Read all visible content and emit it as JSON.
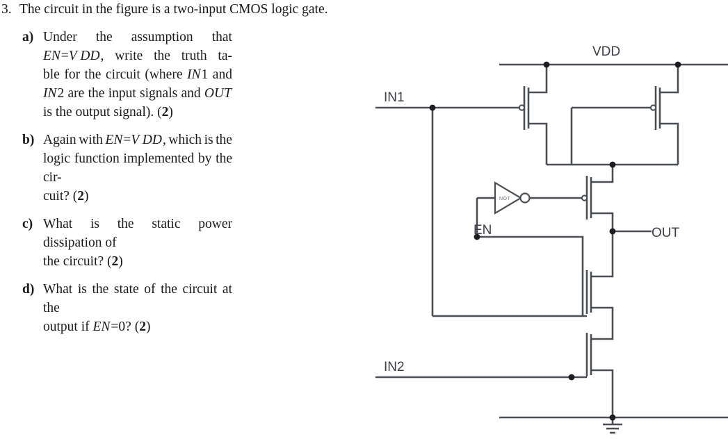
{
  "question": {
    "number": "3.",
    "stem": "The circuit in the figure is a two-input CMOS logic gate.",
    "items": [
      {
        "label": "a)",
        "lines": [
          {
            "words": [
              "Under",
              "the",
              "assumption",
              "that"
            ],
            "spread": true
          },
          {
            "words": [
              "EN=VDD,",
              "write",
              "the",
              "truth",
              "ta-"
            ],
            "spread": true,
            "italic_first": true
          },
          {
            "words": [
              "ble",
              "for",
              "the",
              "circuit",
              "(where",
              "IN1",
              "and"
            ],
            "spread": true
          },
          {
            "words": [
              "IN2",
              "are",
              "the",
              "input",
              "signals",
              "and",
              "OUT"
            ],
            "spread": true
          },
          {
            "words": [
              "is the output signal). (2)"
            ],
            "spread": false
          }
        ],
        "plain": "Under the assumption that EN=VDD, write the truth table for the circuit (where IN1 and IN2 are the input signals and OUT is the output signal). (2)",
        "points": "2"
      },
      {
        "label": "b)",
        "lines": [
          {
            "words": [
              "Again",
              "with",
              "EN=VDD,",
              "which",
              "is",
              "the"
            ],
            "spread": true
          },
          {
            "words": [
              "logic function implemented by the cir-"
            ],
            "spread": false
          },
          {
            "words": [
              "cuit? (2)"
            ],
            "spread": false
          }
        ],
        "plain": "Again with EN=VDD, which is the logic function implemented by the circuit? (2)",
        "points": "2"
      },
      {
        "label": "c)",
        "lines": [
          {
            "words": [
              "What is the static power dissipation of"
            ],
            "spread": false
          },
          {
            "words": [
              "the circuit? (2)"
            ],
            "spread": false
          }
        ],
        "plain": "What is the static power dissipation of the circuit? (2)",
        "points": "2"
      },
      {
        "label": "d)",
        "lines": [
          {
            "words": [
              "What is the state of the circuit at the"
            ],
            "spread": false
          },
          {
            "words": [
              "output if EN=0? (2)"
            ],
            "spread": false
          }
        ],
        "plain": "What is the state of the circuit at the output if EN=0? (2)",
        "points": "2"
      }
    ]
  },
  "figure": {
    "title": "two-input CMOS logic gate schematic",
    "labels": {
      "vdd": "VDD",
      "in1": "IN1",
      "in2": "IN2",
      "en": "EN",
      "out": "OUT",
      "not_gate": "NOT"
    },
    "colors": {
      "wire": "#4a4f55",
      "node": "#1b1d20",
      "text": "#3b3f45"
    },
    "devices": [
      {
        "name": "pmos-in1",
        "type": "PMOS",
        "gate": "IN1"
      },
      {
        "name": "pmos-in2",
        "type": "PMOS",
        "gate": "IN2"
      },
      {
        "name": "pmos-en-bar",
        "type": "PMOS",
        "gate": "EN-bar"
      },
      {
        "name": "nmos-in1",
        "type": "NMOS",
        "gate": "IN1"
      },
      {
        "name": "nmos-en",
        "type": "NMOS",
        "gate": "EN"
      },
      {
        "name": "nmos-in2",
        "type": "NMOS",
        "gate": "IN2"
      }
    ]
  }
}
